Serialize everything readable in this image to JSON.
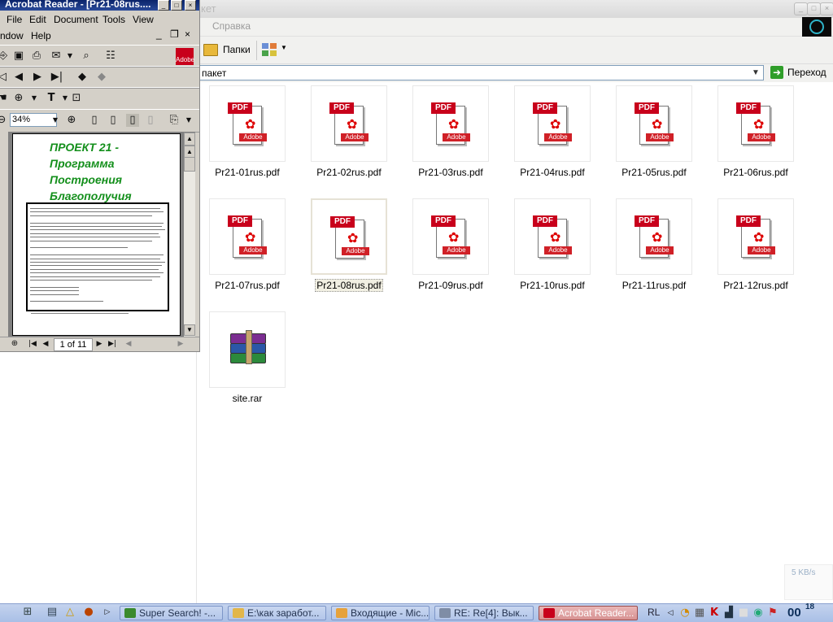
{
  "explorer": {
    "title_fragment": "кет",
    "menu_help": "Справка",
    "toolbar_folders": "Папки",
    "address_value": "пакет",
    "go_label": "Переход",
    "speed_label": "5 KB/s",
    "files": [
      {
        "name": "Pr21-01rus.pdf",
        "type": "pdf"
      },
      {
        "name": "Pr21-02rus.pdf",
        "type": "pdf"
      },
      {
        "name": "Pr21-03rus.pdf",
        "type": "pdf"
      },
      {
        "name": "Pr21-04rus.pdf",
        "type": "pdf"
      },
      {
        "name": "Pr21-05rus.pdf",
        "type": "pdf"
      },
      {
        "name": "Pr21-06rus.pdf",
        "type": "pdf"
      },
      {
        "name": "Pr21-07rus.pdf",
        "type": "pdf"
      },
      {
        "name": "Pr21-08rus.pdf",
        "type": "pdf",
        "selected": true
      },
      {
        "name": "Pr21-09rus.pdf",
        "type": "pdf"
      },
      {
        "name": "Pr21-10rus.pdf",
        "type": "pdf"
      },
      {
        "name": "Pr21-11rus.pdf",
        "type": "pdf"
      },
      {
        "name": "Pr21-12rus.pdf",
        "type": "pdf"
      },
      {
        "name": "site.rar",
        "type": "rar"
      }
    ],
    "pdf_badge": "PDF",
    "pdf_brand": "Adobe"
  },
  "acrobat": {
    "title": "Acrobat Reader - [Pr21-08rus....",
    "menu": {
      "file": "File",
      "edit": "Edit",
      "document": "Document",
      "tools": "Tools",
      "view": "View",
      "window": "ndow",
      "help": "Help"
    },
    "zoom": "34%",
    "page_indicator": "1 of 11",
    "doc_heading": [
      "ПРОЕКТ 21 -",
      "Программа",
      "Построения",
      "Благополучия"
    ]
  },
  "taskbar": {
    "tasks": [
      {
        "label": "Super Search! -...",
        "icon_color": "#3a8a2e"
      },
      {
        "label": "E:\\как заработ...",
        "icon_color": "#e2b64a"
      },
      {
        "label": "Входящие - Mic...",
        "icon_color": "#e6a23c"
      },
      {
        "label": "RE: Re[4]: Вык...",
        "icon_color": "#7f8da6"
      },
      {
        "label": "Acrobat Reader...",
        "icon_color": "#c8001b",
        "active": true
      }
    ],
    "lang": "RL",
    "clock_hour": "00",
    "clock_min": "18"
  },
  "colors": {
    "pdf_red": "#c8001b",
    "address_green": "#2f9e2a",
    "doc_green": "#138f1b",
    "taskbar": "#a9bfe6"
  }
}
